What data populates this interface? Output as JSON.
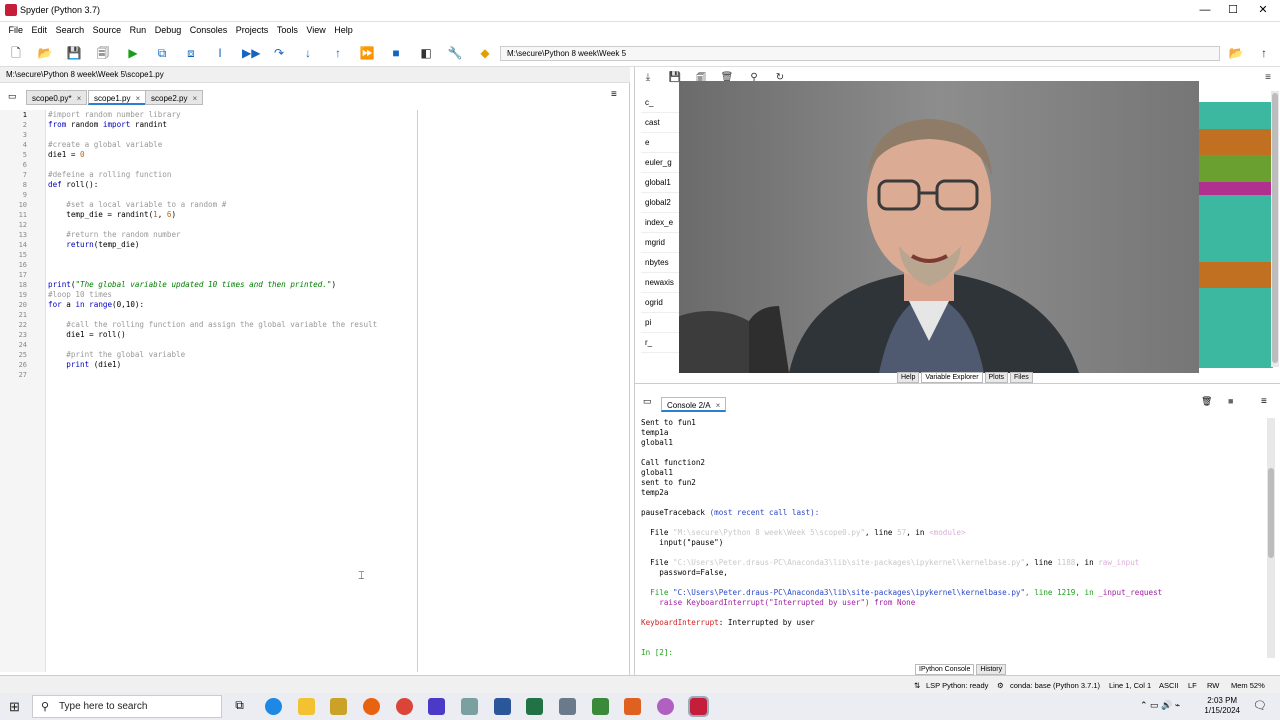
{
  "window": {
    "title": "Spyder (Python 3.7)",
    "minimize": "—",
    "maximize": "☐",
    "close": "✕"
  },
  "menu": [
    "File",
    "Edit",
    "Search",
    "Source",
    "Run",
    "Debug",
    "Consoles",
    "Projects",
    "Tools",
    "View",
    "Help"
  ],
  "toolbar": {
    "path": "M:\\secure\\Python 8 week\\Week 5"
  },
  "editor": {
    "file_path": "M:\\secure\\Python 8 week\\Week 5\\scope1.py",
    "tabs": [
      {
        "label": "scope0.py*",
        "close": "×"
      },
      {
        "label": "scope1.py",
        "close": "×"
      },
      {
        "label": "scope2.py",
        "close": "×"
      }
    ],
    "line_numbers": [
      "1",
      "2",
      "3",
      "4",
      "5",
      "6",
      "7",
      "8",
      "9",
      "10",
      "11",
      "12",
      "13",
      "14",
      "15",
      "16",
      "17",
      "18",
      "19",
      "20",
      "21",
      "22",
      "23",
      "24",
      "25",
      "26",
      "27"
    ],
    "code": {
      "l1": "#import random number library",
      "l2a": "from",
      "l2b": " random ",
      "l2c": "import",
      "l2d": " randint",
      "l4": "#create a global variable",
      "l5a": "die1 = ",
      "l5b": "0",
      "l7": "#defeine a rolling function",
      "l8a": "def",
      "l8b": " roll():",
      "l10": "    #set a local variable to a random #",
      "l11a": "    temp_die = randint(",
      "l11b": "1",
      "l11c": ", ",
      "l11d": "6",
      "l11e": ")",
      "l13": "    #return the random number",
      "l14a": "    ",
      "l14b": "return",
      "l14c": "(temp_die)",
      "l18a": "print",
      "l18b": "(",
      "l18c": "\"The global variable updated 10 times and then printed.\"",
      "l18d": ")",
      "l19": "#loop 10 times",
      "l20a": "for",
      "l20b": " a ",
      "l20c": "in",
      "l20d": " ",
      "l20e": "range",
      "l20f": "(0,10):",
      "l22": "    #call the rolling function and assign the global variable the result",
      "l23": "    die1 = roll()",
      "l25": "    #print the global variable",
      "l26a": "    ",
      "l26b": "print",
      "l26c": " (die1)"
    }
  },
  "variables": [
    "c_",
    "cast",
    "e",
    "euler_g",
    "global1",
    "global2",
    "index_e",
    "mgrid",
    "nbytes",
    "newaxis",
    "ogrid",
    "pi",
    "r_"
  ],
  "var_colors": [
    "#3cb8a0",
    "#3cb8a0",
    "#c07020",
    "#c07020",
    "#6aa030",
    "#6aa030",
    "#b03090",
    "#3cb8a0",
    "#3cb8a0",
    "#3cb8a0",
    "#3cb8a0",
    "#3cb8a0",
    "#c07020",
    "#c07020",
    "#3cb8a0",
    "#3cb8a0",
    "#3cb8a0",
    "#3cb8a0",
    "#3cb8a0",
    "#3cb8a0"
  ],
  "right_tabs": [
    "Help",
    "Variable Explorer",
    "Plots",
    "Files"
  ],
  "console": {
    "tab_label": "Console 2/A",
    "tab_close": "×",
    "lines": {
      "c1": "Sent to fun1",
      "c2": "temp1a",
      "c3": "global1",
      "c5": "Call function2",
      "c6": "global1",
      "c7": "sent to fun2",
      "c8": "temp2a",
      "c10a": "pauseTraceback ",
      "c10b": "(most recent call last):",
      "c12a": "  File ",
      "c12b": "\"M:\\secure\\Python 8 week\\Week 5\\scope0.py\"",
      "c12c": ", line ",
      "c12d": "57",
      "c12e": ", in ",
      "c12f": "<module>",
      "c13": "    input(\"pause\")",
      "c15a": "  File ",
      "c15b": "\"C:\\Users\\Peter.draus-PC\\Anaconda3\\lib\\site-packages\\ipykernel\\kernelbase.py\"",
      "c15c": ", line ",
      "c15d": "1188",
      "c15e": ", in ",
      "c15f": "raw_input",
      "c16": "    password=False,",
      "c18a": "  File ",
      "c18b": "\"C:\\Users\\Peter.draus-PC\\Anaconda3\\lib\\site-packages\\ipykernel\\kernelbase.py\"",
      "c18c": ", line ",
      "c18d": "1219",
      "c18e": ", in ",
      "c18f": "_input_request",
      "c19": "    raise KeyboardInterrupt(\"Interrupted by user\") from None",
      "c21a": "KeyboardInterrupt",
      "c21b": ": Interrupted by user",
      "c24": "In [2]:"
    },
    "bottom_tabs": [
      "IPython Console",
      "History"
    ]
  },
  "status": {
    "lsp": "LSP Python: ready",
    "conda": "conda: base (Python 3.7.1)",
    "position": "Line 1, Col 1",
    "encoding": "ASCII",
    "eol": "LF",
    "rw": "RW",
    "mem": "Mem 52%"
  },
  "taskbar": {
    "search_placeholder": "Type here to search",
    "time": "2:03 PM",
    "date": "1/15/2024",
    "apps": [
      "task-view",
      "edge",
      "file-explorer",
      "media",
      "firefox",
      "chrome",
      "vlc",
      "git",
      "word",
      "excel",
      "notepad",
      "spyder",
      "snip",
      "itunes",
      "spyder-active"
    ]
  }
}
